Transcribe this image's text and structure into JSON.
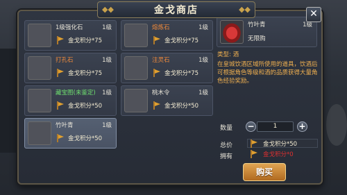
{
  "shop": {
    "title": "金戈商店",
    "close_label": "✕"
  },
  "items": [
    {
      "name": "1级强化石",
      "level": "1级",
      "price": "金戈积分*75",
      "name_color": "#e8e4d8",
      "icon": "white-stone-icon",
      "selected": false
    },
    {
      "name": "熔炼石",
      "level": "1级",
      "price": "金戈积分*75",
      "name_color": "#f08a3a",
      "icon": "orange-stone-icon",
      "selected": false
    },
    {
      "name": "打孔石",
      "level": "1级",
      "price": "金戈积分*75",
      "name_color": "#f08a3a",
      "icon": "blue-stone-icon",
      "selected": false
    },
    {
      "name": "注灵石",
      "level": "1级",
      "price": "金戈积分*75",
      "name_color": "#f08a3a",
      "icon": "green-stone-icon",
      "selected": false
    },
    {
      "name": "藏宝图(未鉴定)",
      "level": "1级",
      "price": "金戈积分*50",
      "name_color": "#6fe06f",
      "icon": "treasure-map-icon",
      "selected": false
    },
    {
      "name": "桃木令",
      "level": "1级",
      "price": "金戈积分*50",
      "name_color": "#e8e4d8",
      "icon": "token-icon",
      "selected": false
    },
    {
      "name": "竹叶青",
      "level": "1级",
      "price": "金戈积分*50",
      "name_color": "#e8e4d8",
      "icon": "wine-jar-icon",
      "selected": true
    }
  ],
  "detail": {
    "name": "竹叶青",
    "level": "1级",
    "limit": "无限购",
    "type": "类型: 酒",
    "description": "在皇城饮酒区域所使用的道具，饮酒后可根据角色等级和酒的品质获得大量角色经验奖励。"
  },
  "purchase": {
    "quantity_label": "数量",
    "quantity": "1",
    "minus_label": "−",
    "plus_label": "+",
    "total_label": "总价",
    "total_value": "金戈积分*50",
    "owned_label": "拥有",
    "owned_value": "金戈积分*0",
    "buy_label": "购买"
  },
  "colors": {
    "accent_gold": "#c9a24c",
    "owned_red": "#e03030",
    "desc_orange": "#f0b050"
  }
}
